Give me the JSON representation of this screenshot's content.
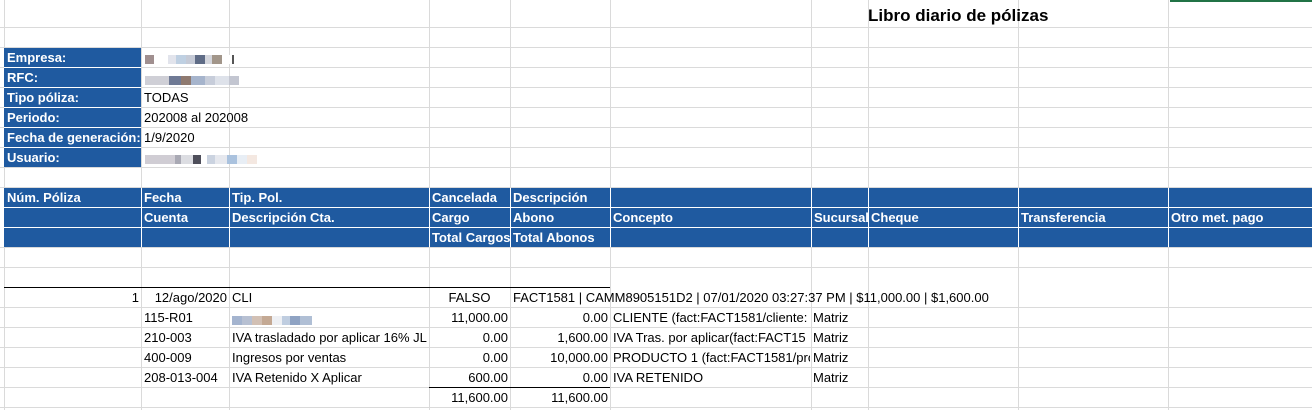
{
  "title": "Libro diario de pólizas",
  "info": {
    "empresa_label": "Empresa:",
    "rfc_label": "RFC:",
    "tipo_label": "Tipo póliza:",
    "tipo_value": "TODAS",
    "periodo_label": "Periodo:",
    "periodo_value": "202008 al 202008",
    "fecha_label": "Fecha de generación:",
    "fecha_value": "1/9/2020",
    "usuario_label": "Usuario:"
  },
  "headers": {
    "row1": [
      "Núm. Póliza",
      "Fecha",
      "Tip. Pol.",
      "Cancelada",
      "Descripción"
    ],
    "row2": [
      "Cuenta",
      "Descripción Cta.",
      "Cargo",
      "Abono",
      "Concepto",
      "Sucursal",
      "Cheque",
      "Transferencia",
      "Otro met. pago"
    ],
    "row3": [
      "Total Cargos",
      "Total Abonos"
    ]
  },
  "poliza": {
    "num": "1",
    "fecha": "12/ago/2020",
    "tipo": "CLI",
    "cancelada": "FALSO",
    "descripcion": "FACT1581 | CAMM8905151D2 | 07/01/2020 03:27:37 PM | $11,000.00 | $1,600.00"
  },
  "rows": [
    {
      "cuenta": "115-R01",
      "desc": "",
      "cargo": "11,000.00",
      "abono": "0.00",
      "concepto": "CLIENTE (fact:FACT1581/cliente:",
      "sucursal": "Matriz"
    },
    {
      "cuenta": "210-003",
      "desc": "IVA trasladado por aplicar 16% JL",
      "cargo": "0.00",
      "abono": "1,600.00",
      "concepto": "IVA Tras. por aplicar(fact:FACT15",
      "sucursal": "Matriz"
    },
    {
      "cuenta": "400-009",
      "desc": "Ingresos por ventas",
      "cargo": "0.00",
      "abono": "10,000.00",
      "concepto": "PRODUCTO 1 (fact:FACT1581/pro",
      "sucursal": "Matriz"
    },
    {
      "cuenta": "208-013-004",
      "desc": "IVA Retenido X Aplicar",
      "cargo": "600.00",
      "abono": "0.00",
      "concepto": "IVA RETENIDO",
      "sucursal": "Matriz"
    }
  ],
  "totals": {
    "cargos": "11,600.00",
    "abonos": "11,600.00"
  },
  "colors": {
    "header_blue": "#1f5aa0",
    "gridline": "#dadada",
    "active_cell_green": "#217346"
  }
}
